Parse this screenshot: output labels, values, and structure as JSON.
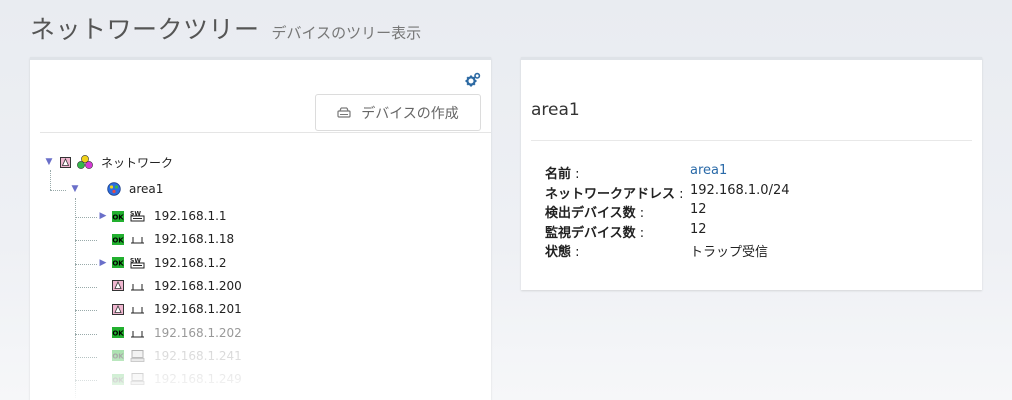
{
  "header": {
    "title": "ネットワークツリー",
    "subtitle": "デバイスのツリー表示"
  },
  "left_panel": {
    "settings_icon": "gears-icon",
    "create_button_label": "デバイスの作成",
    "tree": {
      "root": {
        "label": "ネットワーク",
        "expanded": true,
        "status": "warning"
      },
      "area": {
        "label": "area1",
        "expanded": true
      },
      "devices": [
        {
          "label": "192.168.1.1",
          "status": "OK",
          "type": "switch",
          "expandable": true
        },
        {
          "label": "192.168.1.18",
          "status": "OK",
          "type": "host",
          "expandable": false
        },
        {
          "label": "192.168.1.2",
          "status": "OK",
          "type": "switch",
          "expandable": true
        },
        {
          "label": "192.168.1.200",
          "status": "warning",
          "type": "host",
          "expandable": false
        },
        {
          "label": "192.168.1.201",
          "status": "warning",
          "type": "host",
          "expandable": false
        },
        {
          "label": "192.168.1.202",
          "status": "OK",
          "type": "host",
          "expandable": false
        },
        {
          "label": "192.168.1.241",
          "status": "OK",
          "type": "computer",
          "expandable": false
        },
        {
          "label": "192.168.1.249",
          "status": "OK",
          "type": "computer",
          "expandable": false
        }
      ]
    }
  },
  "right_panel": {
    "title": "area1",
    "details": [
      {
        "key": "名前",
        "value": "area1",
        "link": true
      },
      {
        "key": "ネットワークアドレス",
        "value": "192.168.1.0/24",
        "link": false
      },
      {
        "key": "検出デバイス数",
        "value": "12",
        "link": false
      },
      {
        "key": "監視デバイス数",
        "value": "12",
        "link": false
      },
      {
        "key": "状態",
        "value": "トラップ受信",
        "link": false
      }
    ]
  },
  "colors": {
    "link": "#2a6aa8",
    "ok_badge": "#22b02f",
    "warning_badge": "#f0b7d0",
    "toggle": "#6a6fc9"
  }
}
